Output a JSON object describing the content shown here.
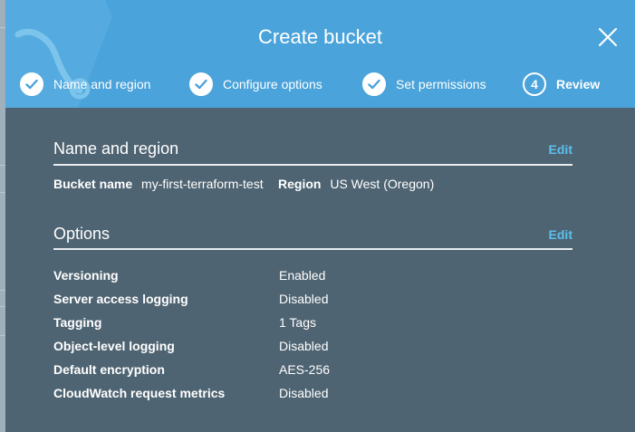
{
  "header": {
    "title": "Create bucket",
    "close_icon": "close-icon"
  },
  "steps": [
    {
      "label": "Name and region",
      "state": "done",
      "icon": "checkmark-icon"
    },
    {
      "label": "Configure options",
      "state": "done",
      "icon": "checkmark-icon"
    },
    {
      "label": "Set permissions",
      "state": "done",
      "icon": "checkmark-icon"
    },
    {
      "label": "Review",
      "state": "active",
      "number": "4"
    }
  ],
  "name_region": {
    "title": "Name and region",
    "edit_label": "Edit",
    "bucket_name_label": "Bucket name",
    "bucket_name_value": "my-first-terraform-test",
    "region_label": "Region",
    "region_value": "US West (Oregon)"
  },
  "options": {
    "title": "Options",
    "edit_label": "Edit",
    "rows": [
      {
        "label": "Versioning",
        "value": "Enabled"
      },
      {
        "label": "Server access logging",
        "value": "Disabled"
      },
      {
        "label": "Tagging",
        "value": "1 Tags"
      },
      {
        "label": "Object-level logging",
        "value": "Disabled"
      },
      {
        "label": "Default encryption",
        "value": "AES-256"
      },
      {
        "label": "CloudWatch request metrics",
        "value": "Disabled"
      }
    ]
  },
  "colors": {
    "header_bg": "#4aa3da",
    "body_bg": "#4f6472",
    "edit_link": "#5bc0ee"
  }
}
